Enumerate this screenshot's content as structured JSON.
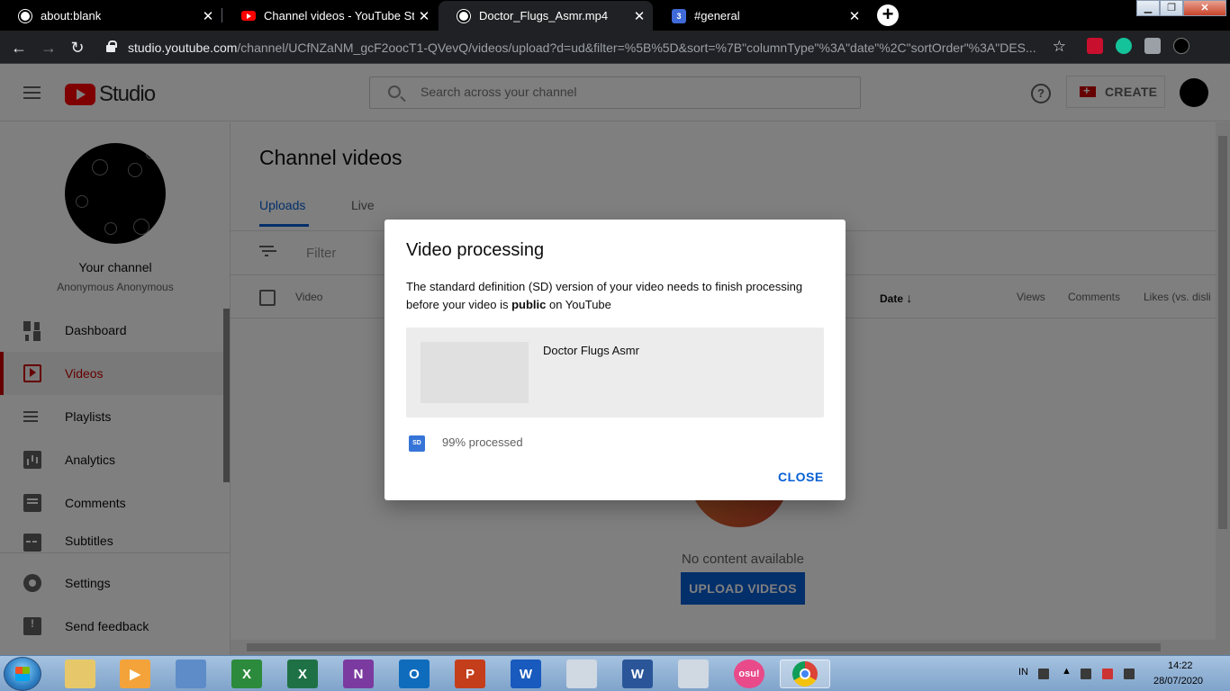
{
  "browser": {
    "tabs": [
      {
        "title": "about:blank",
        "icon": "globe-icon"
      },
      {
        "title": "Channel videos - YouTube Studio",
        "icon": "youtube-icon"
      },
      {
        "title": "Doctor_Flugs_Asmr.mp4",
        "icon": "globe-icon"
      },
      {
        "title": "#general",
        "icon": "slack-icon"
      }
    ],
    "url_host": "studio.youtube.com",
    "url_path": "/channel/UCfNZaNM_gcF2oocT1-QVevQ/videos/upload?d=ud&filter=%5B%5D&sort=%7B\"columnType\"%3A\"date\"%2C\"sortOrder\"%3A\"DES..."
  },
  "header": {
    "logo_text": "Studio",
    "search_placeholder": "Search across your channel",
    "create_label": "CREATE"
  },
  "sidebar": {
    "channel_name": "Your channel",
    "channel_sub": "Anonymous Anonymous",
    "items": [
      {
        "label": "Dashboard",
        "icon": "dashboard-icon"
      },
      {
        "label": "Videos",
        "icon": "videos-icon"
      },
      {
        "label": "Playlists",
        "icon": "playlists-icon"
      },
      {
        "label": "Analytics",
        "icon": "analytics-icon"
      },
      {
        "label": "Comments",
        "icon": "comments-icon"
      },
      {
        "label": "Subtitles",
        "icon": "subtitles-icon"
      }
    ],
    "bottom_items": [
      {
        "label": "Settings",
        "icon": "gear-icon"
      },
      {
        "label": "Send feedback",
        "icon": "feedback-icon"
      }
    ]
  },
  "main": {
    "title": "Channel videos",
    "tabs": [
      {
        "label": "Uploads"
      },
      {
        "label": "Live"
      }
    ],
    "filter_placeholder": "Filter",
    "columns": {
      "video": "Video",
      "date": "Date",
      "views": "Views",
      "comments": "Comments",
      "likes": "Likes (vs. disli"
    },
    "empty_text": "No content available",
    "upload_label": "UPLOAD VIDEOS"
  },
  "dialog": {
    "title": "Video processing",
    "body_prefix": "The standard definition (SD) version of your video needs to finish processing before your video is ",
    "body_bold": "public",
    "body_suffix": " on YouTube",
    "video_title": "Doctor Flugs Asmr",
    "sd_badge": "SD",
    "progress_text": "99% processed",
    "progress_value": 0.99,
    "close_label": "CLOSE"
  },
  "taskbar": {
    "lang": "IN",
    "time": "14:22",
    "date": "28/07/2020"
  },
  "colors": {
    "accent_blue": "#065fd4",
    "youtube_red": "#ff0000",
    "active_red": "#cc0000"
  }
}
